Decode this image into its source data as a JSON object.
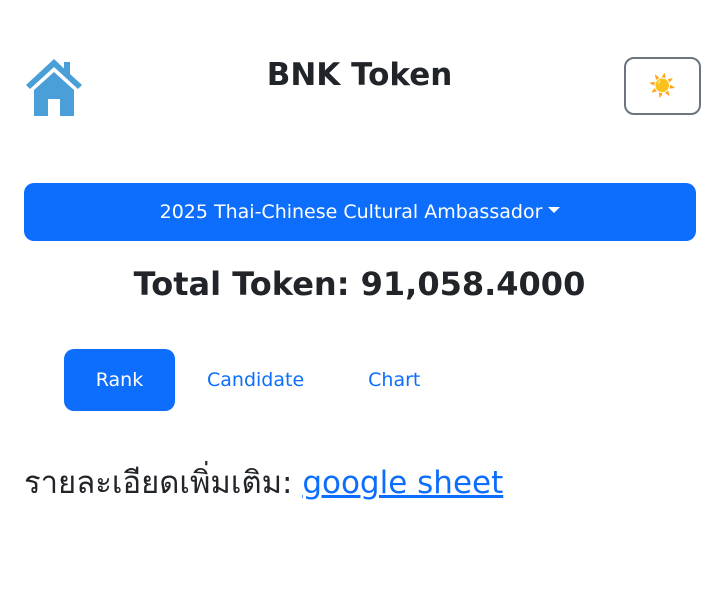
{
  "header": {
    "home_icon": "home-icon",
    "title": "BNK Token",
    "theme_toggle_icon": "☀️"
  },
  "event_selector": {
    "selected": "2025 Thai-Chinese Cultural Ambassador"
  },
  "summary": {
    "total_token_text": "Total Token: 91,058.4000"
  },
  "tabs": [
    {
      "label": "Rank",
      "active": true
    },
    {
      "label": "Candidate",
      "active": false
    },
    {
      "label": "Chart",
      "active": false
    }
  ],
  "details": {
    "label": "รายละเอียดเพิ่มเติม: ",
    "link_text": "google sheet"
  },
  "colors": {
    "primary": "#0d6efd",
    "home_icon": "#4a9fd8",
    "text": "#212529",
    "toggle_border": "#6c757d"
  }
}
